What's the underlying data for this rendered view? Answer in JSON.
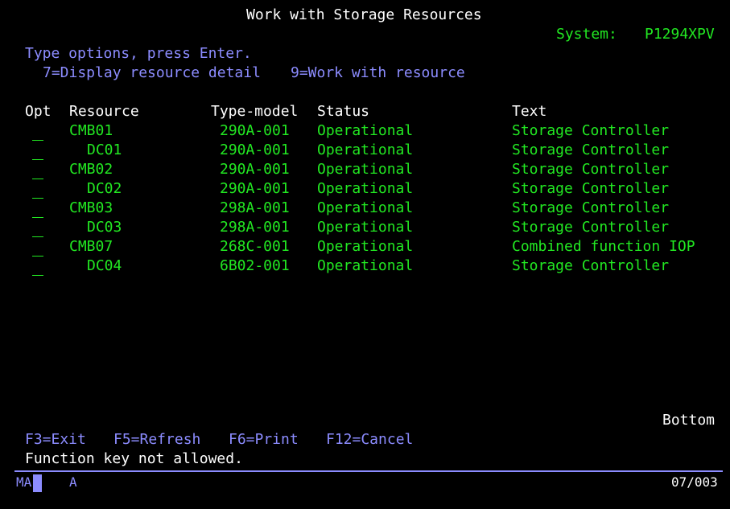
{
  "header": {
    "title": "Work with Storage Resources",
    "system_label": "System:",
    "system_name": "P1294XPV"
  },
  "instructions": {
    "line1": "Type options, press Enter.",
    "option7": "7=Display resource detail",
    "option9": "9=Work with resource"
  },
  "table": {
    "columns": {
      "opt": "Opt",
      "resource": "Resource",
      "type_model": "Type-model",
      "status": "Status",
      "text": "Text"
    },
    "rows": [
      {
        "opt": "",
        "resource": "CMB01",
        "indent": false,
        "type_model": "290A-001",
        "status": "Operational",
        "text": "Storage Controller"
      },
      {
        "opt": "",
        "resource": "DC01",
        "indent": true,
        "type_model": "290A-001",
        "status": "Operational",
        "text": "Storage Controller"
      },
      {
        "opt": "",
        "resource": "CMB02",
        "indent": false,
        "type_model": "290A-001",
        "status": "Operational",
        "text": "Storage Controller"
      },
      {
        "opt": "",
        "resource": "DC02",
        "indent": true,
        "type_model": "290A-001",
        "status": "Operational",
        "text": "Storage Controller"
      },
      {
        "opt": "",
        "resource": "CMB03",
        "indent": false,
        "type_model": "298A-001",
        "status": "Operational",
        "text": "Storage Controller"
      },
      {
        "opt": "",
        "resource": "DC03",
        "indent": true,
        "type_model": "298A-001",
        "status": "Operational",
        "text": "Storage Controller"
      },
      {
        "opt": "",
        "resource": "CMB07",
        "indent": false,
        "type_model": "268C-001",
        "status": "Operational",
        "text": "Combined function IOP"
      },
      {
        "opt": "",
        "resource": "DC04",
        "indent": true,
        "type_model": "6B02-001",
        "status": "Operational",
        "text": "Storage Controller"
      }
    ]
  },
  "bottom_indicator": "Bottom",
  "function_keys": {
    "f3": "F3=Exit",
    "f5": "F5=Refresh",
    "f6": "F6=Print",
    "f12": "F12=Cancel"
  },
  "message": "Function key not allowed.",
  "status_line": {
    "left": "MA",
    "indicator": "A",
    "cursor_position": "07/003"
  },
  "colors": {
    "background": "#000000",
    "white_text": "#ffffff",
    "green_text": "#22e822",
    "blue_text": "#8c8cff"
  }
}
